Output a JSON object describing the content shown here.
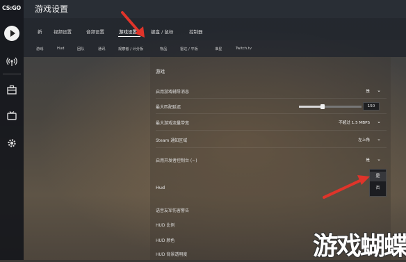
{
  "app": {
    "logo_text": "CS:GO",
    "title": "游戏设置"
  },
  "rail": {
    "icons": [
      "play-icon",
      "antenna-icon",
      "inventory-icon",
      "tv-icon",
      "gear-icon"
    ]
  },
  "tabs_primary": [
    {
      "label": "新"
    },
    {
      "label": "视频设置"
    },
    {
      "label": "音频设置"
    },
    {
      "label": "游戏设置",
      "active": true
    },
    {
      "label": "键盘 / 鼠标"
    },
    {
      "label": "控制器"
    }
  ],
  "tabs_secondary": [
    {
      "label": "游戏"
    },
    {
      "label": "Hud"
    },
    {
      "label": "团队"
    },
    {
      "label": "通讯"
    },
    {
      "label": "观察者 / 计分板"
    },
    {
      "label": "物品"
    },
    {
      "label": "雷达 / 平板"
    },
    {
      "label": "准星"
    },
    {
      "label": "Twitch.tv"
    }
  ],
  "game": {
    "section_title": "游戏",
    "rows": [
      {
        "label": "启用游戏辅导消息",
        "value": "是"
      },
      {
        "label": "最大匹配延迟",
        "slider_value": 150,
        "slider_fraction": 0.38
      },
      {
        "label": "最大游戏流量带宽",
        "value": "不超过 1.5 MBPS"
      },
      {
        "label": "Steam 通知区域",
        "value": "左上角"
      },
      {
        "label": "启用开发者控制台 (~)",
        "value": "是"
      }
    ],
    "dropdown_options": [
      {
        "label": "是",
        "selected": true
      },
      {
        "label": "否"
      }
    ]
  },
  "hud": {
    "section_title": "Hud",
    "rows": [
      {
        "label": "语音友军伤害警告"
      },
      {
        "label": "HUD 比例"
      },
      {
        "label": "HUD 颜色"
      },
      {
        "label": "HUD 背景透明度"
      }
    ]
  },
  "colors": {
    "accent_arrow": "#e0342a"
  },
  "watermark": "游戏蝴蝶"
}
